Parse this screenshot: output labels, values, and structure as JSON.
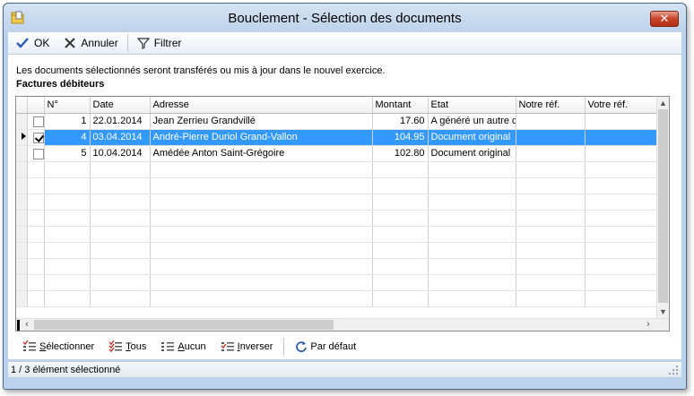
{
  "window": {
    "title": "Bouclement - Sélection des documents"
  },
  "toolbar": {
    "ok_label": "OK",
    "cancel_label": "Annuler",
    "filter_label": "Filtrer"
  },
  "info_text": "Les documents sélectionnés seront transférés ou mis à jour dans le nouvel exercice.",
  "section_label": "Factures débiteurs",
  "table": {
    "columns": [
      "N°",
      "Date",
      "Adresse",
      "Montant",
      "Etat",
      "Notre réf.",
      "Votre réf."
    ],
    "rows": [
      {
        "checked": false,
        "selected": false,
        "num": "1",
        "date": "22.01.2014",
        "address": "Jean Zerrieu Grandvillé",
        "amount": "17.60",
        "state": "A généré un autre d",
        "our_ref": "",
        "your_ref": ""
      },
      {
        "checked": true,
        "selected": true,
        "num": "4",
        "date": "03.04.2014",
        "address": "André-Pierre Duriol Grand-Vallon",
        "amount": "104.95",
        "state": "Document original",
        "our_ref": "",
        "your_ref": ""
      },
      {
        "checked": false,
        "selected": false,
        "num": "5",
        "date": "10.04.2014",
        "address": "Amédée Anton Saint-Grégoire",
        "amount": "102.80",
        "state": "Document original",
        "our_ref": "",
        "your_ref": ""
      }
    ]
  },
  "bottom_toolbar": {
    "select_prefix": "S",
    "select_label": "électionner",
    "all_underline": "T",
    "all_label": "ous",
    "none_underline": "A",
    "none_label": "ucun",
    "invert_underline": "I",
    "invert_label": "nverser",
    "default_label": "Par défaut"
  },
  "status": {
    "text": "1 / 3 élément sélectionné"
  },
  "colors": {
    "selection": "#3399ff",
    "close": "#c7432a",
    "frame": "#bcd2ea"
  }
}
